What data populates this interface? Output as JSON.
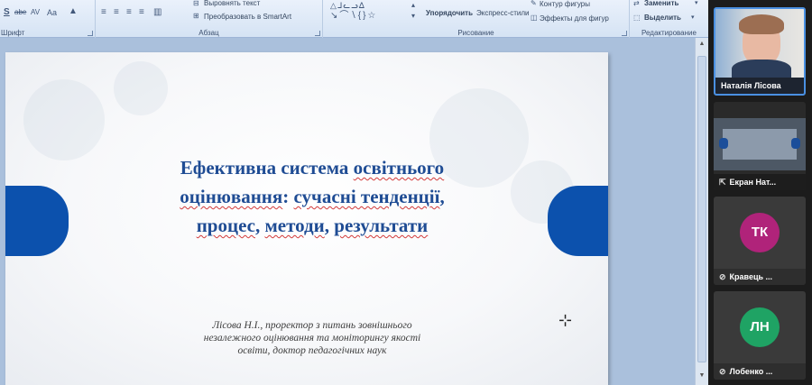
{
  "ribbon": {
    "groups": {
      "font": "Шрифт",
      "paragraph": "Абзац",
      "drawing": "Рисование",
      "editing": "Редактирование"
    },
    "paragraph": {
      "align_text": "Выровнять текст",
      "convert_smartart": "Преобразовать в SmartArt"
    },
    "drawing": {
      "arrange": "Упорядочить",
      "quick_styles": "Экспресс-стили",
      "shape_outline": "Контур фигуры",
      "shape_effects": "Эффекты для фигур"
    },
    "editing": {
      "replace": "Заменить",
      "select": "Выделить"
    },
    "font_icons": [
      "S",
      "abe",
      "AV",
      "Aa"
    ]
  },
  "slide": {
    "title": {
      "line1_a": "Ефективна система ",
      "line1_b": "освітнього",
      "line2_a": "оцінювання",
      "line2_b": ": ",
      "line2_c": "сучасні тенденції",
      "line2_d": ",",
      "line3_a": "процес",
      "line3_b": ", ",
      "line3_c": "методи",
      "line3_d": ", ",
      "line3_e": "результати"
    },
    "subtitle": {
      "line1": "Лісова Н.І., проректор з питань зовнішнього",
      "line2": "незалежного оцінювання та моніторингу якості",
      "line3": "освіти, доктор педагогічних наук"
    }
  },
  "participants": [
    {
      "name": "Наталія Лісова",
      "type": "video"
    },
    {
      "name": "Екран Нат...",
      "type": "screen"
    },
    {
      "name": "Кравець ...",
      "initials": "ТК",
      "avatar_color": "#b0237a",
      "muted": true
    },
    {
      "name": "Лобенко ...",
      "initials": "ЛН",
      "avatar_color": "#1fa364",
      "muted": true
    }
  ],
  "colors": {
    "pill": "#0c51ad",
    "title": "#1f4c94",
    "active_tile_border": "#4a90e2"
  }
}
